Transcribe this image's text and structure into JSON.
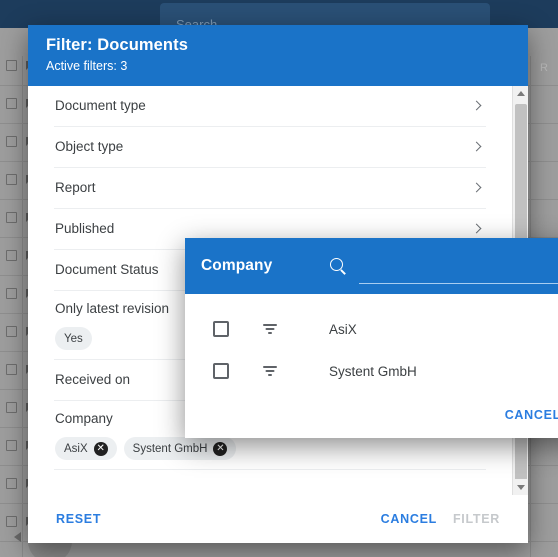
{
  "background": {
    "search_placeholder": "Search",
    "column_header": "R",
    "row_count": 12
  },
  "filter_dialog": {
    "title": "Filter: Documents",
    "subtitle": "Active filters: 3",
    "rows": [
      {
        "label": "Document type",
        "type": "chevron"
      },
      {
        "label": "Object type",
        "type": "chevron"
      },
      {
        "label": "Report",
        "type": "chevron"
      },
      {
        "label": "Published",
        "type": "chevron"
      },
      {
        "label": "Document Status",
        "type": "chevron"
      },
      {
        "label": "Only latest revision",
        "type": "chips",
        "chips": [
          {
            "text": "Yes",
            "removable": false
          }
        ]
      },
      {
        "label": "Received on",
        "type": "plain"
      },
      {
        "label": "Company",
        "type": "chips",
        "chips": [
          {
            "text": "AsiX",
            "removable": true
          },
          {
            "text": "Systent GmbH",
            "removable": true
          }
        ]
      }
    ],
    "actions": {
      "reset": "RESET",
      "cancel": "CANCEL",
      "filter": "FILTER",
      "filter_disabled": true
    },
    "scrollbar": {
      "up_icon": "scroll-up-arrow",
      "down_icon": "scroll-down-arrow"
    }
  },
  "company_dialog": {
    "title": "Company",
    "search_value": "",
    "search_placeholder": "",
    "search_icon": "search-icon",
    "items": [
      {
        "label": "AsiX",
        "checked": false,
        "filter_icon": "filter-list-icon"
      },
      {
        "label": "Systent GmbH",
        "checked": false,
        "filter_icon": "filter-list-icon"
      }
    ],
    "actions": {
      "cancel": "CANCEL"
    }
  },
  "colors": {
    "accent_blue": "#1a73c8",
    "link_blue": "#2b7de0",
    "topbar_navy": "#1d3c5c",
    "chip_bg": "#eceff1",
    "disabled_grey": "#c6c9cc"
  }
}
